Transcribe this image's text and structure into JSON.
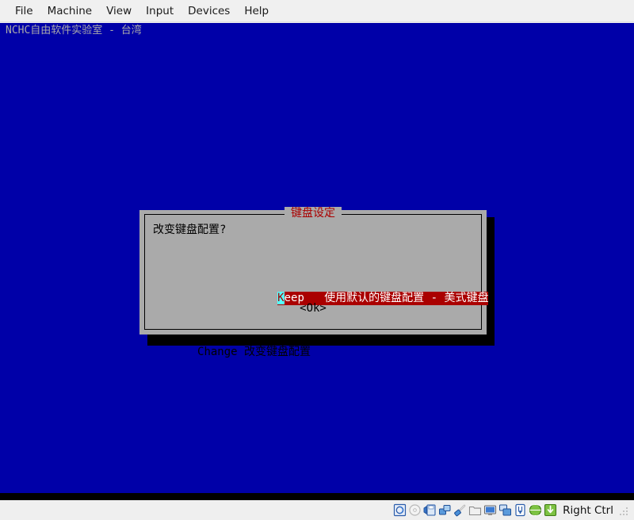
{
  "window": {
    "menubar": [
      {
        "label": "File",
        "name": "menu-file"
      },
      {
        "label": "Machine",
        "name": "menu-machine"
      },
      {
        "label": "View",
        "name": "menu-view"
      },
      {
        "label": "Input",
        "name": "menu-input"
      },
      {
        "label": "Devices",
        "name": "menu-devices"
      },
      {
        "label": "Help",
        "name": "menu-help"
      }
    ]
  },
  "vm": {
    "background_color": "#0000a8",
    "console_header": "NCHC自由软件实验室 - 台湾"
  },
  "dialog": {
    "title": "键盘设定",
    "title_color": "#aa0000",
    "prompt": "改变键盘配置?",
    "background_color": "#aaaaaa",
    "options": [
      {
        "hotkey": "K",
        "rest": "eep",
        "description": "使用默认的键盘配置 - 美式键盘",
        "full_text": "Keep   使用默认的键盘配置 - 美式键盘",
        "selected": true,
        "selected_bg": "#aa0000",
        "hotkey_bg": "#55ffff"
      },
      {
        "hotkey": "C",
        "rest": "hange",
        "description": "改变键盘配置",
        "full_text": "Change 改变键盘配置",
        "selected": false
      }
    ],
    "ok_button": "<Ok>"
  },
  "statusbar": {
    "icons": [
      {
        "name": "hard-disk-icon",
        "title": "Hard Disks"
      },
      {
        "name": "optical-disk-icon",
        "title": "Optical Drives"
      },
      {
        "name": "floppy-disk-icon",
        "title": "Floppy Drives"
      },
      {
        "name": "network-icon",
        "title": "Network"
      },
      {
        "name": "usb-icon",
        "title": "USB Devices"
      },
      {
        "name": "shared-folders-icon",
        "title": "Shared Folders"
      },
      {
        "name": "display-icon",
        "title": "Display"
      },
      {
        "name": "recording-icon",
        "title": "Recording"
      },
      {
        "name": "features-icon",
        "title": "VM Features"
      },
      {
        "name": "mouse-integration-icon",
        "title": "Mouse Integration"
      },
      {
        "name": "host-key-icon",
        "title": "Host Key"
      }
    ],
    "host_key_label": "Right Ctrl"
  }
}
